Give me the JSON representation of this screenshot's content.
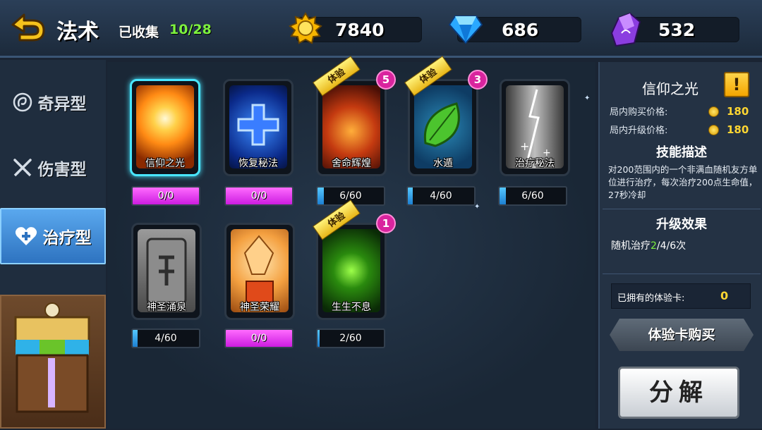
{
  "header": {
    "title": "法术",
    "collected_label": "已收集",
    "collected_count": "10/28",
    "currency": {
      "gold": "7840",
      "gem": "686",
      "crystal": "532"
    }
  },
  "sidebar": {
    "tabs": [
      {
        "label": "奇异型",
        "icon": "swirl-icon"
      },
      {
        "label": "伤害型",
        "icon": "crossed-swords-icon"
      },
      {
        "label": "治疗型",
        "icon": "heart-plus-icon",
        "active": true
      }
    ]
  },
  "cards": [
    {
      "name": "信仰之光",
      "progress": "0/0",
      "bar": "pink",
      "fill": 1.0,
      "selected": true,
      "trial": false
    },
    {
      "name": "恢复秘法",
      "progress": "0/0",
      "bar": "pink",
      "fill": 1.0,
      "trial": false
    },
    {
      "name": "舍命辉煌",
      "progress": "6/60",
      "bar": "blue",
      "fill": 0.1,
      "trial": true,
      "trial_label": "体验",
      "badge": "5"
    },
    {
      "name": "水遁",
      "progress": "4/60",
      "bar": "blue",
      "fill": 0.067,
      "trial": true,
      "trial_label": "体验",
      "badge": "3"
    },
    {
      "name": "治疗秘法",
      "progress": "6/60",
      "bar": "blue",
      "fill": 0.1,
      "trial": false
    },
    {
      "name": "神圣涌泉",
      "progress": "4/60",
      "bar": "blue",
      "fill": 0.067,
      "trial": false
    },
    {
      "name": "神圣荣耀",
      "progress": "0/0",
      "bar": "pink",
      "fill": 1.0,
      "trial": false
    },
    {
      "name": "生生不息",
      "progress": "2/60",
      "bar": "blue",
      "fill": 0.033,
      "trial": true,
      "trial_label": "体验",
      "badge": "1"
    }
  ],
  "detail": {
    "title": "信仰之光",
    "info_button": "!",
    "buy_price_label": "局内购买价格:",
    "buy_price": "180",
    "upgrade_price_label": "局内升级价格:",
    "upgrade_price": "180",
    "skill_heading": "技能描述",
    "skill_desc": "对200范围内的一个非满血随机友方单位进行治疗，每次治疗200点生命值，27秒冷却",
    "upgrade_heading": "升级效果",
    "upgrade_prefix": "随机治疗",
    "upgrade_highlight": "2",
    "upgrade_suffix": "/4/6次",
    "owned_label": "已拥有的体验卡:",
    "owned_value": "0",
    "buy_trial_button": "体验卡购买",
    "decompose_button": "分解"
  },
  "colors": {
    "accent_green": "#7df13e",
    "gold_text": "#ffd632",
    "selected_border": "#49e6ff",
    "active_tab": "#3c8ad8"
  }
}
